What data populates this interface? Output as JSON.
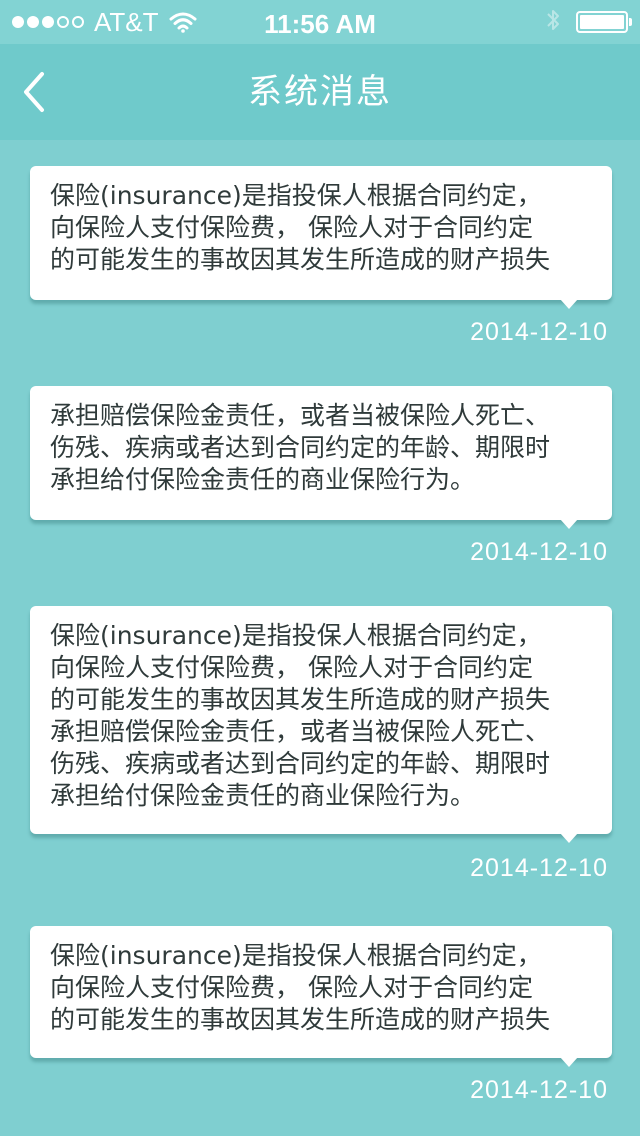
{
  "status_bar": {
    "carrier": "AT&T",
    "time": "11:56 AM",
    "signal_bars_filled": 3,
    "signal_bars_total": 5,
    "icons": [
      "signal-dots-icon",
      "wifi-icon",
      "bluetooth-icon",
      "battery-icon"
    ],
    "battery_level": 1.0
  },
  "nav": {
    "title": "系统消息",
    "back_icon": "chevron-left-icon"
  },
  "colors": {
    "background": "#7fcfd0",
    "nav_background": "#6fcacb",
    "bubble": "#ffffff",
    "text": "#2f3a3a"
  },
  "messages": [
    {
      "lines": [
        "保险(insurance)是指投保人根据合同约定，",
        "向保险人支付保险费， 保险人对于合同约定",
        "的可能发生的事故因其发生所造成的财产损失"
      ],
      "date": "2014-12-10"
    },
    {
      "lines": [
        "承担赔偿保险金责任，或者当被保险人死亡、",
        "伤残、疾病或者达到合同约定的年龄、期限时",
        "承担给付保险金责任的商业保险行为。"
      ],
      "date": "2014-12-10"
    },
    {
      "lines": [
        "保险(insurance)是指投保人根据合同约定，",
        "向保险人支付保险费， 保险人对于合同约定",
        "的可能发生的事故因其发生所造成的财产损失",
        "承担赔偿保险金责任，或者当被保险人死亡、",
        "伤残、疾病或者达到合同约定的年龄、期限时",
        "承担给付保险金责任的商业保险行为。"
      ],
      "date": "2014-12-10"
    },
    {
      "lines": [
        "保险(insurance)是指投保人根据合同约定，",
        "向保险人支付保险费， 保险人对于合同约定",
        "的可能发生的事故因其发生所造成的财产损失"
      ],
      "date": "2014-12-10"
    }
  ]
}
